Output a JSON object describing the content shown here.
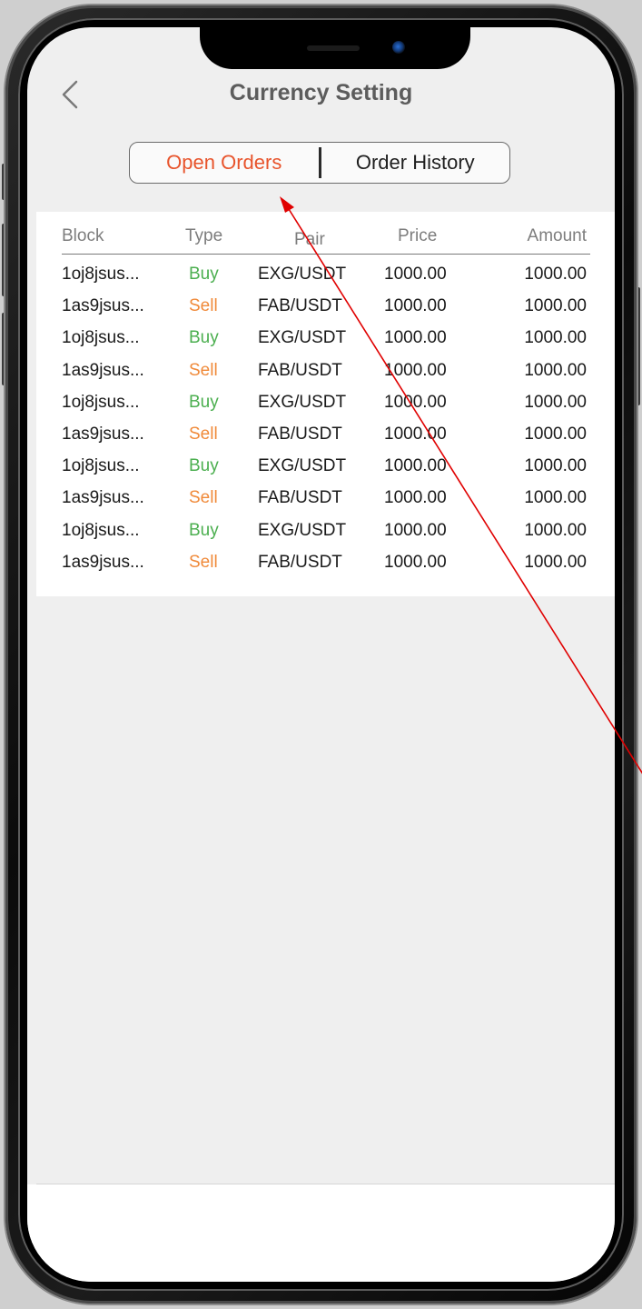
{
  "header": {
    "title": "Currency Setting",
    "back_icon": "chevron-left-icon"
  },
  "tabs": [
    {
      "label": "Open Orders",
      "active": true
    },
    {
      "label": "Order History",
      "active": false
    }
  ],
  "colors": {
    "active_tab": "#e8542c",
    "buy": "#4caf50",
    "sell": "#f08a3a",
    "annotation_arrow": "#e00000"
  },
  "table": {
    "columns": [
      "Block",
      "Type",
      "Pair",
      "Price",
      "Amount"
    ],
    "rows": [
      {
        "block": "1oj8jsus...",
        "type": "Buy",
        "pair": "EXG/USDT",
        "price": "1000.00",
        "amount": "1000.00"
      },
      {
        "block": "1as9jsus...",
        "type": "Sell",
        "pair": "FAB/USDT",
        "price": "1000.00",
        "amount": "1000.00"
      },
      {
        "block": "1oj8jsus...",
        "type": "Buy",
        "pair": "EXG/USDT",
        "price": "1000.00",
        "amount": "1000.00"
      },
      {
        "block": "1as9jsus...",
        "type": "Sell",
        "pair": "FAB/USDT",
        "price": "1000.00",
        "amount": "1000.00"
      },
      {
        "block": "1oj8jsus...",
        "type": "Buy",
        "pair": "EXG/USDT",
        "price": "1000.00",
        "amount": "1000.00"
      },
      {
        "block": "1as9jsus...",
        "type": "Sell",
        "pair": "FAB/USDT",
        "price": "1000.00",
        "amount": "1000.00"
      },
      {
        "block": "1oj8jsus...",
        "type": "Buy",
        "pair": "EXG/USDT",
        "price": "1000.00",
        "amount": "1000.00"
      },
      {
        "block": "1as9jsus...",
        "type": "Sell",
        "pair": "FAB/USDT",
        "price": "1000.00",
        "amount": "1000.00"
      },
      {
        "block": "1oj8jsus...",
        "type": "Buy",
        "pair": "EXG/USDT",
        "price": "1000.00",
        "amount": "1000.00"
      },
      {
        "block": "1as9jsus...",
        "type": "Sell",
        "pair": "FAB/USDT",
        "price": "1000.00",
        "amount": "1000.00"
      }
    ]
  }
}
